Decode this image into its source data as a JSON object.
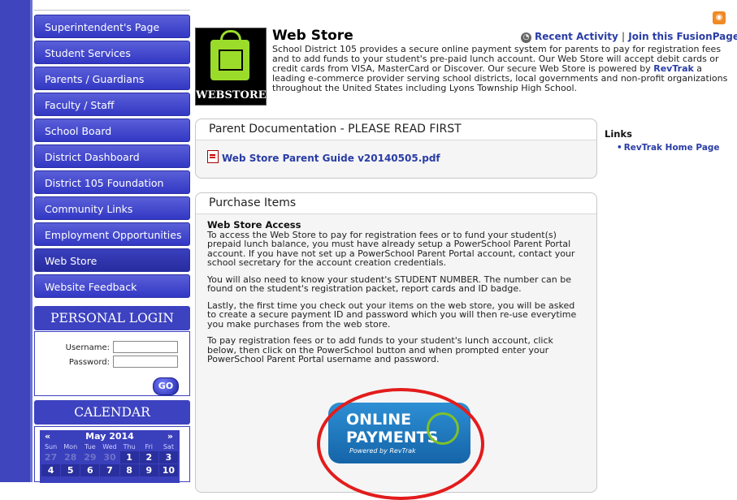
{
  "sidebar": {
    "items": [
      {
        "label": "Superintendent's Page"
      },
      {
        "label": "Student Services"
      },
      {
        "label": "Parents / Guardians"
      },
      {
        "label": "Faculty / Staff"
      },
      {
        "label": "School Board"
      },
      {
        "label": "District Dashboard"
      },
      {
        "label": "District 105 Foundation"
      },
      {
        "label": "Community Links"
      },
      {
        "label": "Employment Opportunities"
      },
      {
        "label": "Web Store"
      },
      {
        "label": "Website Feedback"
      }
    ]
  },
  "login": {
    "heading": "PERSONAL LOGIN",
    "username_label": "Username:",
    "password_label": "Password:",
    "go_label": "GO"
  },
  "calendar": {
    "heading": "CALENDAR",
    "prev": "«",
    "next": "»",
    "month": "May 2014",
    "dows": [
      "Sun",
      "Mon",
      "Tue",
      "Wed",
      "Thu",
      "Fri",
      "Sat"
    ],
    "week1": [
      "27",
      "28",
      "29",
      "30",
      "1",
      "2",
      "3"
    ],
    "week2": [
      "4",
      "5",
      "6",
      "7",
      "8",
      "9",
      "10"
    ]
  },
  "header": {
    "logo_text": "WEBSTORE",
    "title": "Web Store",
    "recent_activity": "Recent Activity",
    "separator": "|",
    "join": "Join this FusionPage",
    "intro_before": "School District 105 provides a secure online payment system for parents to pay for registration fees and to add funds to your student's pre-paid lunch account. Our Web Store will accept debit cards or credit cards from VISA, MasterCard or Discover. Our secure Web Store is powered by ",
    "intro_link": "RevTrak",
    "intro_after": " a leading e-commerce provider serving school districts, local governments and non-profit organizations throughout the United States including Lyons Township High School."
  },
  "docs_panel": {
    "title": "Parent Documentation - PLEASE READ FIRST",
    "file_link": "Web Store Parent Guide v20140505.pdf"
  },
  "purchase_panel": {
    "title": "Purchase Items",
    "subheading": "Web Store Access",
    "p1": "To access the Web Store to pay for registration fees or to fund your student(s) prepaid lunch balance, you must have already setup a PowerSchool Parent Portal account. If you have not set up a PowerSchool Parent Portal account, contact your school secretary for the account creation credentials.",
    "p2": "You will also need to know your student's STUDENT NUMBER. The number can be found on the student's registration packet, report cards and ID badge.",
    "p3": "Lastly, the first time you check out your items on the web store, you will be asked to create a secure payment ID and password which you will then re-use everytime you make purchases from the web store.",
    "p4": "To pay registration fees or to add funds to your student's lunch account, click below, then click on the PowerSchool button and when prompted enter your PowerSchool Parent Portal username and password.",
    "badge_line1": "ONLINE",
    "badge_line2": "PAYMENTS",
    "badge_line3": "Powered by RevTrak"
  },
  "links": {
    "heading": "Links",
    "items": [
      "RevTrak Home Page"
    ]
  }
}
